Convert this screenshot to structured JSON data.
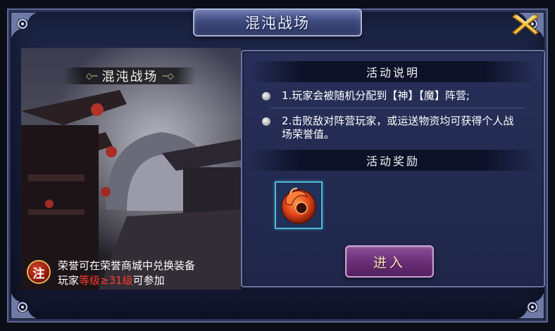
{
  "window": {
    "title": "混沌战场"
  },
  "scene": {
    "banner": "混沌战场"
  },
  "note": {
    "icon_text": "注",
    "line1": "荣誉可在荣誉商城中兑换装备",
    "line2_prefix": "玩家",
    "line2_requirement": "等级≥31级",
    "line2_suffix": "可参加"
  },
  "activity": {
    "description_title": "活动说明",
    "rules": [
      "1.玩家会被随机分配到【神】【魔】阵营;",
      "2.击败敌对阵营玩家，或运送物资均可获得个人战场荣誉值。"
    ],
    "reward_title": "活动奖励",
    "rewards": [
      {
        "icon": "red-jade-pendant-icon"
      }
    ]
  },
  "buttons": {
    "enter_label": "进入",
    "close_icon": "close-x-icon"
  },
  "colors": {
    "requirement": "#ff3b2e",
    "frame_border": "#5d6794",
    "button_purple": "#6a2f78"
  }
}
